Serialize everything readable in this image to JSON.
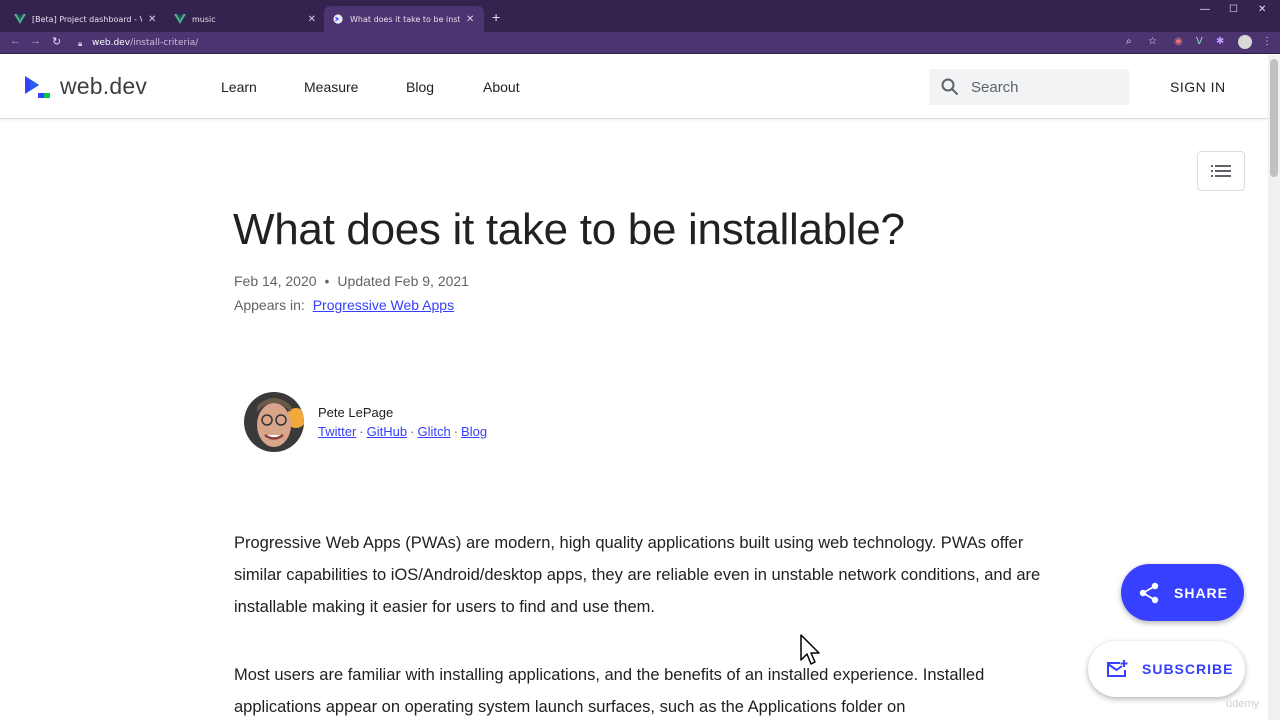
{
  "browser": {
    "tabs": [
      {
        "title": "[Beta] Project dashboard - Vue CLI",
        "active": false
      },
      {
        "title": "music",
        "active": false
      },
      {
        "title": "What does it take to be installable?",
        "active": true
      }
    ],
    "url_host": "web.dev",
    "url_path": "/install-criteria/"
  },
  "header": {
    "logo_text": "web.dev",
    "nav": [
      "Learn",
      "Measure",
      "Blog",
      "About"
    ],
    "search_placeholder": "Search",
    "signin_label": "SIGN IN"
  },
  "article": {
    "title": "What does it take to be installable?",
    "published": "Feb 14, 2020",
    "updated": "Updated Feb 9, 2021",
    "appears_label": "Appears in:",
    "appears_link": "Progressive Web Apps",
    "author": {
      "name": "Pete LePage",
      "links": [
        "Twitter",
        "GitHub",
        "Glitch",
        "Blog"
      ]
    },
    "paragraphs": [
      "Progressive Web Apps (PWAs) are modern, high quality applications built using web technology. PWAs offer similar capabilities to iOS/Android/desktop apps, they are reliable even in unstable network conditions, and are installable making it easier for users to find and use them.",
      "Most users are familiar with installing applications, and the benefits of an installed experience. Installed applications appear on operating system launch surfaces, such as the Applications folder on"
    ]
  },
  "fabs": {
    "share_label": "SHARE",
    "subscribe_label": "SUBSCRIBE"
  },
  "watermark": "ūdemy",
  "colors": {
    "accent": "#3740ff",
    "chrome_tabbar": "#35234f",
    "chrome_toolbar": "#4b3470"
  }
}
